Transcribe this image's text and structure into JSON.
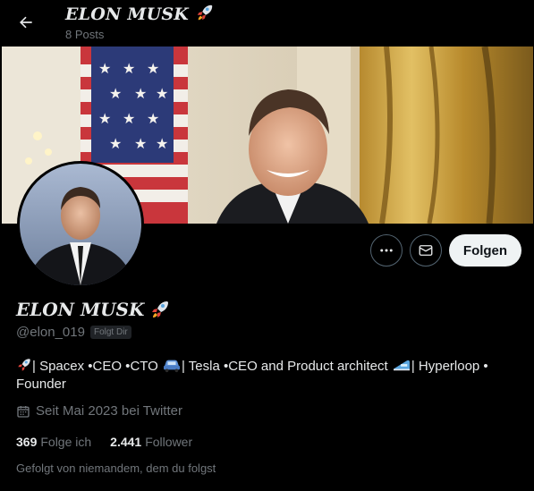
{
  "header": {
    "back_icon": "arrow-left-icon",
    "name": "ELON MUSK",
    "name_emoji": "rocket-emoji",
    "posts_count": "8 Posts"
  },
  "actions": {
    "more_icon": "more-horizontal-icon",
    "message_icon": "mail-icon",
    "follow_label": "Folgen"
  },
  "profile": {
    "name": "ELON MUSK",
    "name_emoji": "rocket-emoji",
    "handle": "@elon_019",
    "follows_you": "Folgt Dir",
    "bio": {
      "part1": "| Spacex •CEO •CTO ",
      "part2": "| Tesla •CEO and Product architect ",
      "part3": "| Hyperloop • Founder"
    },
    "joined_icon": "calendar-icon",
    "joined": "Seit Mai 2023 bei Twitter",
    "following_count": "369",
    "following_label": "Folge ich",
    "followers_count": "2.441",
    "followers_label": "Follower",
    "followed_by": "Gefolgt von niemandem, dem du folgst"
  },
  "colors": {
    "background": "#000000",
    "text": "#e7e9ea",
    "muted": "#71767b",
    "button_light": "#eff3f4",
    "border": "#536471"
  }
}
